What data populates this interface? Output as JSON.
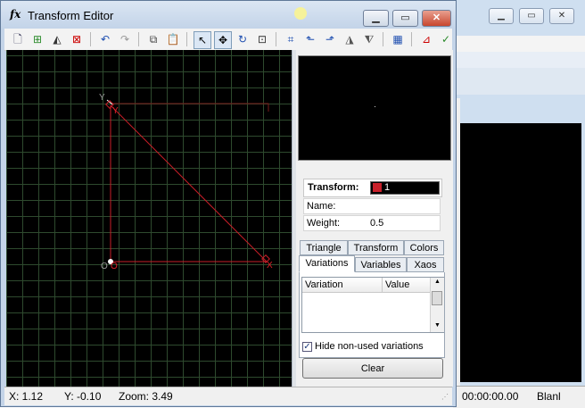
{
  "window": {
    "title": "Transform Editor",
    "title_icon": "fx"
  },
  "background_window": {
    "time": "00:00:00.00",
    "status_text": "Blanl"
  },
  "canvas": {
    "point_labels": {
      "origin_white": "O",
      "origin_red": "O",
      "x_label": "X",
      "y_white": "Y",
      "y_red": "Y"
    },
    "colors": {
      "grid": "#2e4a2e",
      "triangle": "#e0202a",
      "background": "#000000"
    }
  },
  "transform_panel": {
    "transform_label": "Transform:",
    "transform_value": "1",
    "name_label": "Name:",
    "name_value": "",
    "weight_label": "Weight:",
    "weight_value": "0.5"
  },
  "tabs": {
    "row1": [
      "Triangle",
      "Transform",
      "Colors"
    ],
    "row2": [
      "Variations",
      "Variables",
      "Xaos"
    ],
    "active": "Variations"
  },
  "variations": {
    "col_variation": "Variation",
    "col_value": "Value",
    "hide_unused_label": "Hide non-used variations",
    "hide_unused_checked": true,
    "clear_label": "Clear"
  },
  "statusbar": {
    "x": "X: 1.12",
    "y": "Y: -0.10",
    "zoom": "Zoom: 3.49"
  }
}
